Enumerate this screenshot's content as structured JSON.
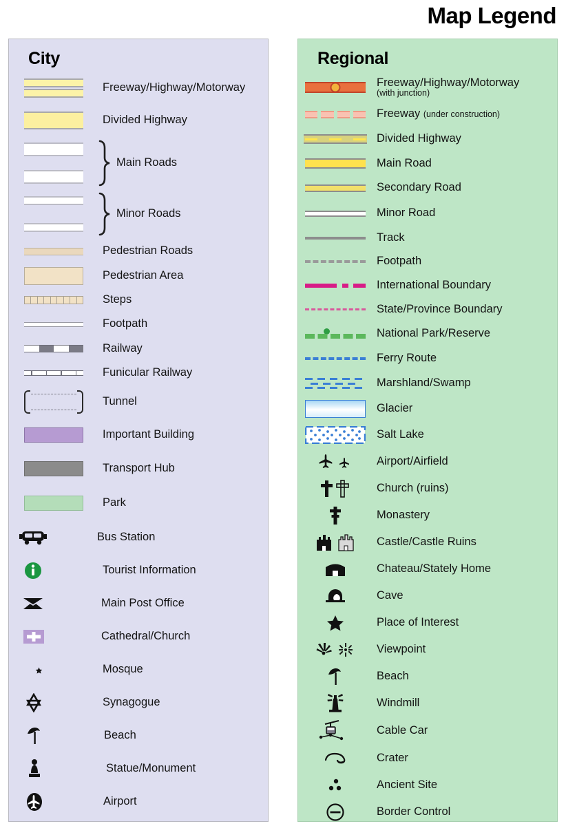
{
  "title": "Map Legend",
  "colors": {
    "city_panel_bg": "#dedef0",
    "regional_panel_bg": "#bee6c6",
    "freeway_orange": "#e9703e",
    "junction_yellow": "#f2b23c",
    "road_yellow": "#ffe14e",
    "boundary_magenta": "#d81c87",
    "park_green": "#5cb85c",
    "water_blue": "#3a7fd5",
    "building_purple": "#b69bd2",
    "hub_grey": "#8b8b8b",
    "park_fill": "#b4ddb9",
    "pedestrian_tan": "#f2e2c6",
    "tourist_info_green": "#1a9641"
  },
  "city": {
    "heading": "City",
    "items": [
      {
        "label": "Freeway/Highway/Motorway",
        "symbol": "freeway-double-yellow"
      },
      {
        "label": "Divided Highway",
        "symbol": "divided-highway-yellow"
      },
      {
        "label": "Main Roads",
        "symbol": "main-roads-bracketed-white"
      },
      {
        "label": "Minor Roads",
        "symbol": "minor-roads-bracketed-white"
      },
      {
        "label": "Pedestrian Roads",
        "symbol": "pedestrian-road-tan"
      },
      {
        "label": "Pedestrian Area",
        "symbol": "pedestrian-area-tan-block"
      },
      {
        "label": "Steps",
        "symbol": "steps-hatched"
      },
      {
        "label": "Footpath",
        "symbol": "footpath-thin-line"
      },
      {
        "label": "Railway",
        "symbol": "railway-dashed-grey"
      },
      {
        "label": "Funicular Railway",
        "symbol": "funicular-ticked-line"
      },
      {
        "label": "Tunnel",
        "symbol": "tunnel-brackets-dashed"
      },
      {
        "label": "Important Building",
        "symbol": "building-purple-block"
      },
      {
        "label": "Transport Hub",
        "symbol": "transport-hub-grey-block"
      },
      {
        "label": "Park",
        "symbol": "park-green-block"
      },
      {
        "label": "Bus Station",
        "symbol": "bus-icon"
      },
      {
        "label": "Tourist Information",
        "symbol": "information-circle-icon"
      },
      {
        "label": "Main Post Office",
        "symbol": "envelope-icon"
      },
      {
        "label": "Cathedral/Church",
        "symbol": "church-cross-block-icon"
      },
      {
        "label": "Mosque",
        "symbol": "crescent-star-icon"
      },
      {
        "label": "Synagogue",
        "symbol": "star-of-david-icon"
      },
      {
        "label": "Beach",
        "symbol": "parasol-icon"
      },
      {
        "label": "Statue/Monument",
        "symbol": "statue-icon"
      },
      {
        "label": "Airport",
        "symbol": "airplane-circle-icon"
      }
    ]
  },
  "regional": {
    "heading": "Regional",
    "items": [
      {
        "label": "Freeway/Highway/Motorway",
        "sub": "(with junction)",
        "sub_style": "block",
        "symbol": "freeway-orange-with-junction"
      },
      {
        "label": "Freeway",
        "sub": "(under construction)",
        "sub_style": "inline",
        "symbol": "freeway-dashed-pink"
      },
      {
        "label": "Divided Highway",
        "symbol": "divided-highway-dashed-yellow"
      },
      {
        "label": "Main Road",
        "symbol": "main-road-yellow"
      },
      {
        "label": "Secondary Road",
        "symbol": "secondary-road-yellow-thin"
      },
      {
        "label": "Minor Road",
        "symbol": "minor-road-white"
      },
      {
        "label": "Track",
        "symbol": "track-grey-line"
      },
      {
        "label": "Footpath",
        "symbol": "footpath-grey-dashed"
      },
      {
        "label": "International Boundary",
        "symbol": "international-boundary-magenta"
      },
      {
        "label": "State/Province Boundary",
        "symbol": "state-boundary-pink-dashed"
      },
      {
        "label": "National Park/Reserve",
        "symbol": "national-park-green-dashed-dot"
      },
      {
        "label": "Ferry Route",
        "symbol": "ferry-route-blue-dashed"
      },
      {
        "label": "Marshland/Swamp",
        "symbol": "marshland-blue-dashes"
      },
      {
        "label": "Glacier",
        "symbol": "glacier-gradient-block"
      },
      {
        "label": "Salt Lake",
        "symbol": "salt-lake-dotted-block"
      },
      {
        "label": "Airport/Airfield",
        "symbol": "airplane-pair-icon"
      },
      {
        "label": "Church (ruins)",
        "symbol": "cross-pair-icon"
      },
      {
        "label": "Monastery",
        "symbol": "monastery-cross-icon"
      },
      {
        "label": "Castle/Castle Ruins",
        "symbol": "castle-pair-icon"
      },
      {
        "label": "Chateau/Stately Home",
        "symbol": "chateau-icon"
      },
      {
        "label": "Cave",
        "symbol": "cave-icon"
      },
      {
        "label": "Place of Interest",
        "symbol": "star-icon"
      },
      {
        "label": "Viewpoint",
        "symbol": "viewpoint-pair-icon"
      },
      {
        "label": "Beach",
        "symbol": "parasol-icon"
      },
      {
        "label": "Windmill",
        "symbol": "windmill-icon"
      },
      {
        "label": "Cable Car",
        "symbol": "cable-car-icon"
      },
      {
        "label": "Crater",
        "symbol": "crater-icon"
      },
      {
        "label": "Ancient Site",
        "symbol": "ancient-site-dots-icon"
      },
      {
        "label": "Border Control",
        "symbol": "border-control-icon"
      }
    ]
  }
}
